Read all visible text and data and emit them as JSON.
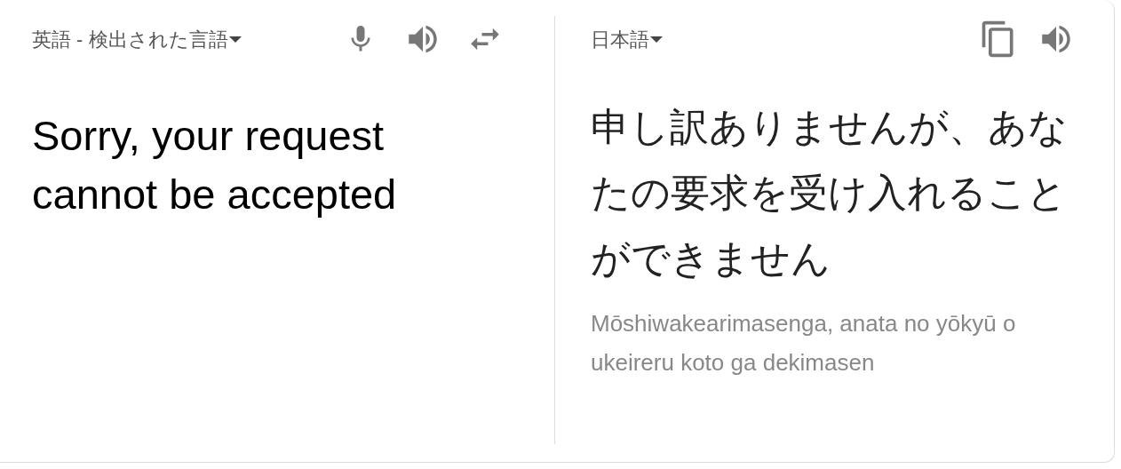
{
  "source": {
    "language": "英語 - 検出された言語",
    "text": "Sorry, your request cannot be accepted"
  },
  "target": {
    "language": "日本語",
    "text": "申し訳ありませんが、あなたの要求を受け入れることができません",
    "romanization": "Mōshiwakearimasenga, anata no yōkyū o ukeireru koto ga dekimasen"
  }
}
